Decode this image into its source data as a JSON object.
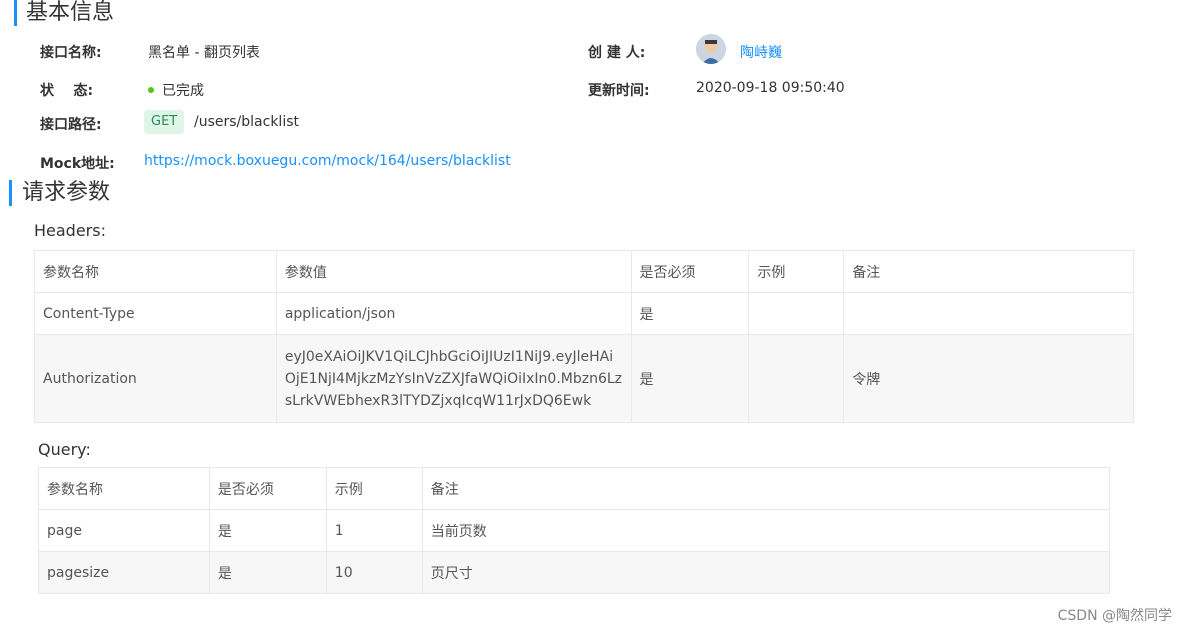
{
  "basic": {
    "title": "基本信息",
    "name_label": "接口名称:",
    "name_value": "黑名单 - 翻页列表",
    "creator_label": "创 建 人:",
    "creator_value": "陶峙巍",
    "status_label": "状    态:",
    "status_value": "已完成",
    "updated_label": "更新时间:",
    "updated_value": "2020-09-18 09:50:40",
    "path_label": "接口路径:",
    "method": "GET",
    "path_value": "/users/blacklist",
    "mock_label": "Mock地址:",
    "mock_value": "https://mock.boxuegu.com/mock/164/users/blacklist"
  },
  "request": {
    "title": "请求参数",
    "headers_title": "Headers:",
    "headers_columns": [
      "参数名称",
      "参数值",
      "是否必须",
      "示例",
      "备注"
    ],
    "headers_rows": [
      [
        "Content-Type",
        "application/json",
        "是",
        "",
        ""
      ],
      [
        "Authorization",
        "eyJ0eXAiOiJKV1QiLCJhbGciOiJIUzI1NiJ9.eyJleHAiOjE1NjI4MjkzMzYsInVzZXJfaWQiOiIxIn0.Mbzn6LzsLrkVWEbhexR3lTYDZjxqIcqW11rJxDQ6Ewk",
        "是",
        "",
        "令牌"
      ]
    ],
    "query_title": "Query:",
    "query_columns": [
      "参数名称",
      "是否必须",
      "示例",
      "备注"
    ],
    "query_rows": [
      [
        "page",
        "是",
        "1",
        "当前页数"
      ],
      [
        "pagesize",
        "是",
        "10",
        "页尺寸"
      ]
    ]
  },
  "watermark": "CSDN @陶然同学",
  "colors": {
    "accent": "#1890ff",
    "status_dot": "#52c41a",
    "method_bg": "#dff5e8",
    "method_text": "#2e8b57"
  }
}
